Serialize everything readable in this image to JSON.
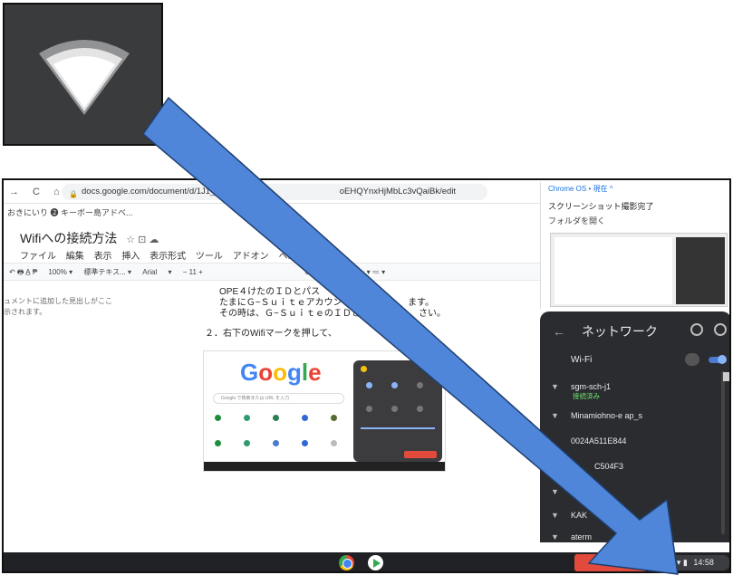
{
  "browser": {
    "url": "docs.google.com/document/d/1J1_crU",
    "url_tail": "oEHQYnxHjMbLc3vQaiBk/edit",
    "bookmarks": "おきにいり  ❷ キーボー島アドベ..."
  },
  "document": {
    "title": "Wifiへの接続方法",
    "title_icons": "☆ ⊡ ☁",
    "menus": [
      "ファイル",
      "編集",
      "表示",
      "挿入",
      "表示形式",
      "ツール",
      "アドオン",
      "ヘルプ"
    ],
    "toolbar": [
      "↶ 🖶 A̲ ₱",
      "100%  ▾",
      "標準テキス...  ▾",
      "Arial",
      "▾",
      "−  11  +"
    ],
    "toolbar_right": "⊖  ⊞  ▭ ▾  ≡ ▾  ‡≡  ≔ ▾  ≔ ▾",
    "outline_hint": "ュメントに追加した見出しがここ\n示されます。",
    "line1": "OPE４けたのＩＤとパス",
    "line2": "たまにＧ−Ｓｕｉｔｅアカウントを",
    "line2_tail": "ます。",
    "line3": "その時は、Ｇ−ＳｕｉｔｅのＩＤとパス",
    "line3_tail": "さい。",
    "step2": "２．右下のWifiマークを押して、"
  },
  "embedded_screenshot": {
    "logo": "Google",
    "search_placeholder": "Google で検索または URL を入力"
  },
  "notification": {
    "source": "Chrome OS • 現在 ^",
    "title": "スクリーンショット撮影完了",
    "action": "フォルダを開く"
  },
  "network_panel": {
    "title": "ネットワーク",
    "wifi_label": "Wi-Fi",
    "networks": [
      {
        "name": "sgm-sch-j1",
        "status": "接続済み"
      },
      {
        "name": "Minamiohno-e ap_s",
        "status": ""
      },
      {
        "name": "0024A511E844",
        "status": ""
      },
      {
        "name": "C504F3",
        "status": ""
      },
      {
        "name": "",
        "status": ""
      },
      {
        "name": "KAK",
        "status": ""
      },
      {
        "name": "aterm",
        "status": ""
      }
    ]
  },
  "tray": {
    "time": "14:58",
    "icons": "∞ ● ▾ ▮"
  },
  "colors": {
    "arrow_fill": "#4f86d9",
    "arrow_stroke": "#1f3f70",
    "panel_bg": "#2b2c2f",
    "connected_green": "#6ee26e"
  }
}
